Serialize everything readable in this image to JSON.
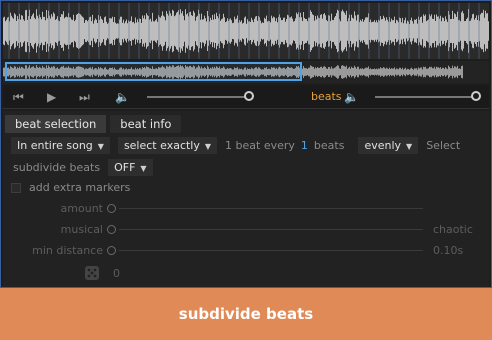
{
  "transport": {
    "beats_label": "beats",
    "volume_level": 1.0,
    "beats_volume_level": 1.0
  },
  "tabs": [
    {
      "label": "beat selection",
      "active": true
    },
    {
      "label": "beat info",
      "active": false
    }
  ],
  "selection_row": {
    "scope": "In entire song",
    "mode": "select exactly",
    "text_prefix": "1 beat every",
    "count": "1",
    "text_suffix": "beats",
    "distribution": "evenly",
    "select_label": "Select"
  },
  "subdivide_row": {
    "label": "subdivide beats",
    "value": "OFF"
  },
  "extra_markers_label": "add extra markers",
  "params": {
    "amount_label": "amount",
    "musical_label": "musical",
    "musical_value": "chaotic",
    "min_distance_label": "min distance",
    "min_distance_value": "0.10s",
    "seed_value": "0"
  },
  "banner_text": "subdivide beats",
  "colors": {
    "accent_orange": "#e6a23c",
    "accent_blue": "#4fa3e6",
    "banner": "#e08a57"
  }
}
